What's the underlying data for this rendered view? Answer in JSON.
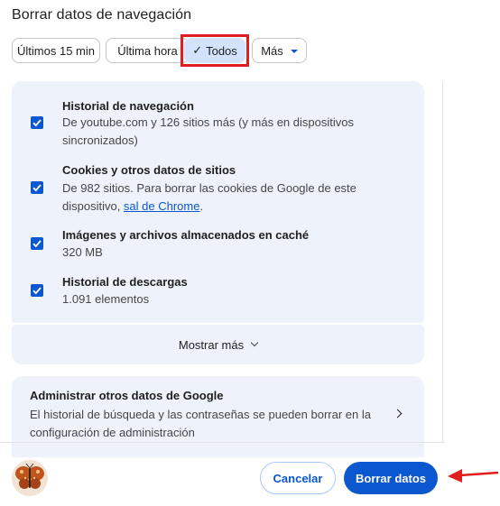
{
  "dialog": {
    "title": "Borrar datos de navegación"
  },
  "time_range": {
    "chips": [
      {
        "label": "Últimos 15 min"
      },
      {
        "label": "Última hora"
      },
      {
        "label": "Todos"
      },
      {
        "label": "Más"
      }
    ],
    "selected": "Todos"
  },
  "options": [
    {
      "title": "Historial de navegación",
      "description": "De youtube.com y 126 sitios más (y más en dispositivos sincronizados)",
      "checked": true
    },
    {
      "title": "Cookies y otros datos de sitios",
      "description_prefix": "De 982 sitios. Para borrar las cookies de Google de este dispositivo, ",
      "link": "sal de Chrome",
      "description_suffix": ".",
      "checked": true
    },
    {
      "title": "Imágenes y archivos almacenados en caché",
      "description": "320 MB",
      "checked": true
    },
    {
      "title": "Historial de descargas",
      "description": "1.091 elementos",
      "checked": true
    }
  ],
  "show_more": {
    "label": "Mostrar más"
  },
  "google_data": {
    "title": "Administrar otros datos de Google",
    "description": "El historial de búsqueda y las contraseñas se pueden borrar en la configuración de administración"
  },
  "footer": {
    "cancel_label": "Cancelar",
    "confirm_label": "Borrar datos"
  },
  "colors": {
    "accent": "#0b57d0",
    "card_bg": "#eef2fa",
    "chip_selected_bg": "#d3e3fd",
    "annotation_red": "#e01e1e"
  }
}
